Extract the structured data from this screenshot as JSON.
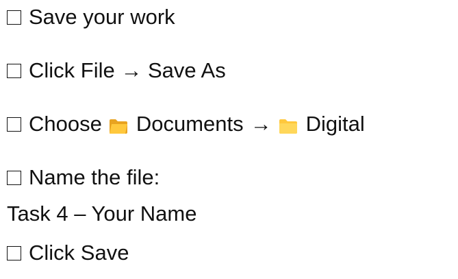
{
  "steps": [
    {
      "text": "Save your work"
    },
    {
      "text": "Click File → Save As"
    },
    {
      "prefix": "Choose",
      "folder1": "Documents",
      "arrow": "→",
      "folder2": "Digital",
      "folder_icon": "folder-icon",
      "folder_color": "#FFC83D"
    },
    {
      "text": "Name the file:",
      "subtext": "Task 4 – Your Name"
    },
    {
      "text": "Click Save"
    }
  ]
}
